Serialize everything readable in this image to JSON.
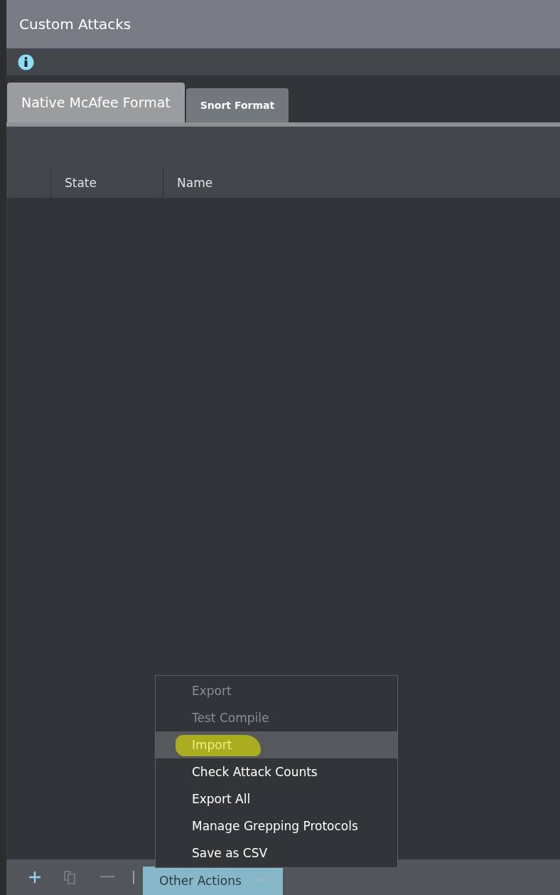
{
  "window": {
    "title": "Custom Attacks"
  },
  "tabs": [
    {
      "label": "Native McAfee Format",
      "selected": true
    },
    {
      "label": "Snort Format",
      "selected": false
    }
  ],
  "table": {
    "columns": [
      "State",
      "Name"
    ]
  },
  "menu": {
    "items": [
      {
        "label": "Export",
        "disabled": true,
        "highlighted": false,
        "marked": false
      },
      {
        "label": "Test Compile",
        "disabled": true,
        "highlighted": false,
        "marked": false
      },
      {
        "label": "Import",
        "disabled": false,
        "highlighted": true,
        "marked": true
      },
      {
        "label": "Check Attack Counts",
        "disabled": false,
        "highlighted": false,
        "marked": false
      },
      {
        "label": "Export All",
        "disabled": false,
        "highlighted": false,
        "marked": false
      },
      {
        "label": "Manage Grepping Protocols",
        "disabled": false,
        "highlighted": false,
        "marked": false
      },
      {
        "label": "Save as CSV",
        "disabled": false,
        "highlighted": false,
        "marked": false
      }
    ]
  },
  "toolbar": {
    "other_actions": "Other Actions"
  }
}
